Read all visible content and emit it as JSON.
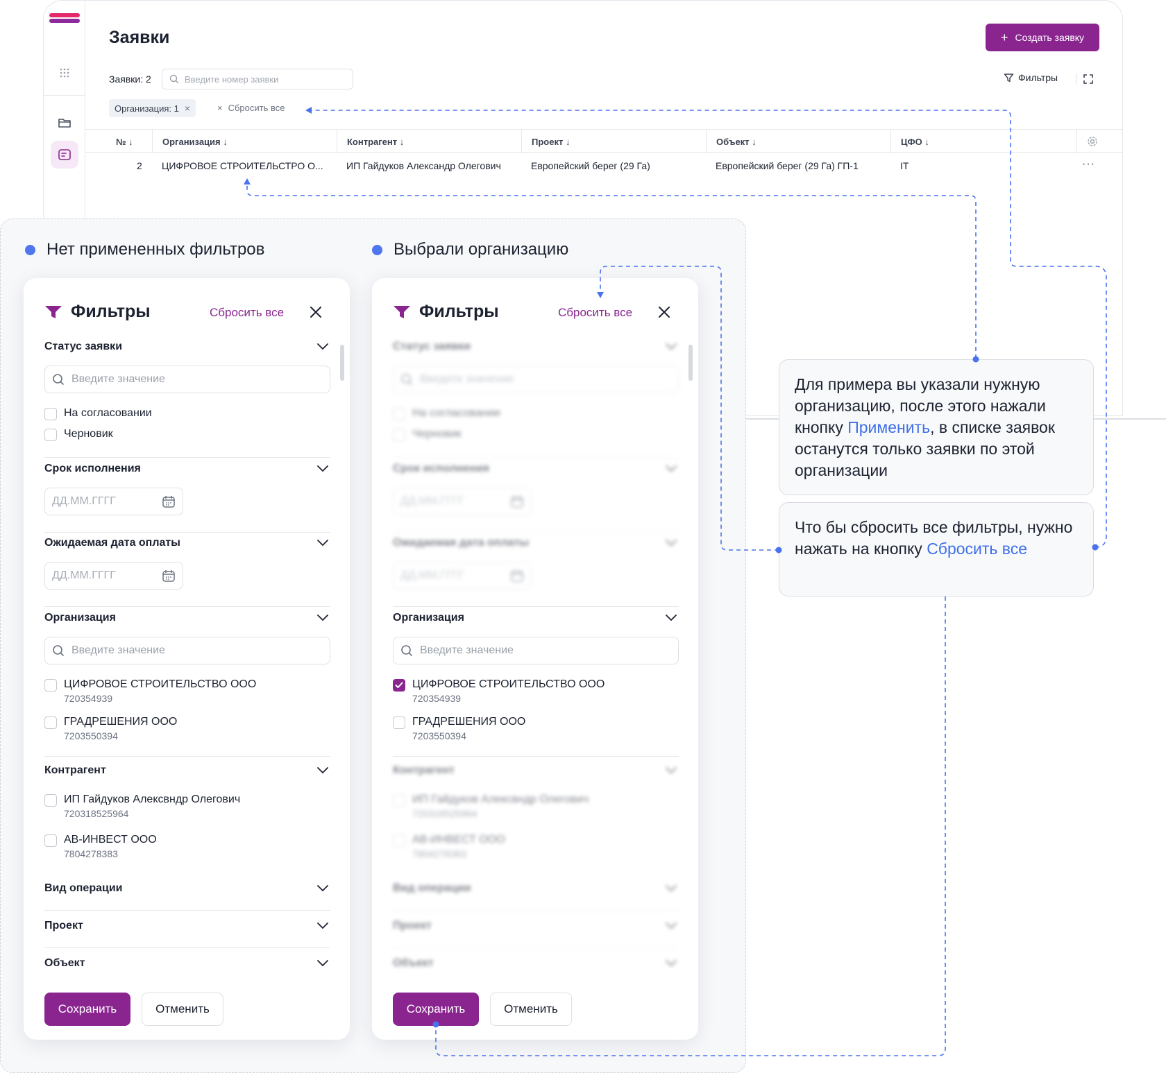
{
  "app": {
    "title": "Заявки",
    "create_button": "Создать заявку",
    "count_label": "Заявки: 2",
    "search_placeholder": "Введите номер заявки",
    "filters_button": "Фильтры",
    "active_chip": "Организация: 1",
    "reset_all": "Сбросить все",
    "table": {
      "columns": [
        "№",
        "Организация",
        "Контрагент",
        "Проект",
        "Объект",
        "ЦФО"
      ],
      "rows": [
        [
          "2",
          "ЦИФРОВОЕ СТРОИТЕЛЬСТРО О...",
          "ИП Гайдуков Александр Олегович",
          "Европейский берег (29 Га)",
          "Европейский берег (29 Га) ГП-1",
          "IT"
        ]
      ]
    }
  },
  "section_labels": {
    "left": "Нет примененных фильтров",
    "right": "Выбрали организацию"
  },
  "filters_panel": {
    "title": "Фильтры",
    "reset_all": "Сбросить все",
    "status": {
      "title": "Статус заявки",
      "placeholder": "Введите значение",
      "options": [
        "На согласовании",
        "Черновик"
      ]
    },
    "deadline": {
      "title": "Срок исполнения",
      "placeholder": "ДД.ММ.ГГГГ"
    },
    "payment_date": {
      "title": "Ожидаемая дата оплаты",
      "placeholder": "ДД.ММ.ГГГГ"
    },
    "organization": {
      "title": "Организация",
      "placeholder": "Введите значение",
      "options": [
        {
          "label": "ЦИФРОВОЕ СТРОИТЕЛЬСТВО ООО",
          "sub": "720354939"
        },
        {
          "label": "ГРАДРЕШЕНИЯ ООО",
          "sub": "7203550394"
        }
      ]
    },
    "counterparty": {
      "title": "Контрагент",
      "options": [
        {
          "label": "ИП Гайдуков Алексвндр Олегович",
          "sub": "720318525964"
        },
        {
          "label": "АВ-ИНВЕСТ ООО",
          "sub": "7804278383"
        }
      ]
    },
    "operation_type": {
      "title": "Вид операции"
    },
    "project": {
      "title": "Проект"
    },
    "object": {
      "title": "Объект"
    },
    "save_button": "Сохранить",
    "cancel_button": "Отменить"
  },
  "callouts": {
    "apply": {
      "before": "Для примера вы указали нужную организацию, после этого нажали кнопку ",
      "highlight": "Применить",
      "after": ", в списке заявок останутся только заявки по этой организации"
    },
    "reset": {
      "before": "Что бы сбросить все фильтры, нужно нажать на кнопку ",
      "highlight": "Сбросить все"
    }
  },
  "colors": {
    "accent": "#8a2590",
    "highlight": "#3f6fe8",
    "dot": "#4f76ef",
    "connector": "#4a72ee"
  },
  "state": {
    "right_panel_checked_organization": "ЦИФРОВОЕ СТРОИТЕЛЬСТВО ООО"
  }
}
